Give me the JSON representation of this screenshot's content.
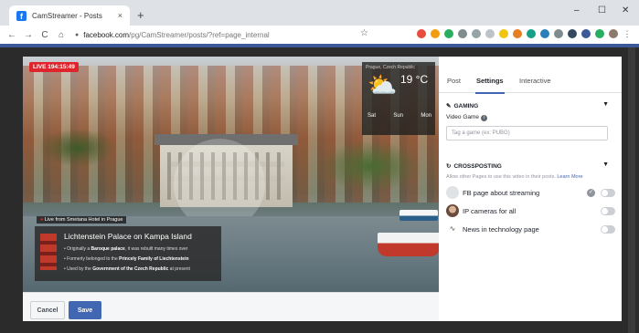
{
  "browser": {
    "tab_title": "CamStreamer - Posts",
    "tab_close": "×",
    "new_tab": "+",
    "url_host": "facebook.com",
    "url_path": "/pg/CamStreamer/posts/?ref=page_internal",
    "win_min": "–",
    "win_max": "☐",
    "win_close": "✕",
    "back": "←",
    "forward": "→",
    "reload": "C",
    "home": "⌂",
    "bookmark_star": "☆"
  },
  "video": {
    "live_badge": "LIVE 194:15:49",
    "location_tag": "Live from Smetana Hotel in Prague",
    "weather": {
      "location": "Prague, Czech Republic",
      "temp": "19 °C",
      "days": [
        {
          "name": "Sat"
        },
        {
          "name": "Sun"
        },
        {
          "name": "Mon"
        }
      ]
    },
    "caption": {
      "title": "Lichtenstein Palace on Kampa Island",
      "line1_pre": "Originally a ",
      "line1_bold": "Baroque palace",
      "line1_post": ", it was rebuilt many times over",
      "line2_pre": "Formerly belonged to the ",
      "line2_bold": "Princely Family of Liechtenstein",
      "line3_pre": "Used by the ",
      "line3_bold": "Government of the Czech Republic",
      "line3_post": " at present"
    }
  },
  "footer": {
    "cancel_label": "Cancel",
    "save_label": "Save"
  },
  "panel": {
    "tabs": [
      "Post",
      "Settings",
      "Interactive"
    ],
    "active_tab": "Settings",
    "gaming": {
      "heading": "GAMING",
      "label": "Video Game",
      "info_icon": "i",
      "placeholder": "Tag a game (ex: PUBG)"
    },
    "crossposting": {
      "heading": "CROSSPOSTING",
      "help": "Allow other Pages to use this video in their posts.",
      "learn_more": "Learn More",
      "pages": [
        {
          "name": "FB page about streaming",
          "verified": true
        },
        {
          "name": "IP cameras for all",
          "verified": false
        },
        {
          "name": "News in technology page",
          "verified": false
        }
      ]
    }
  },
  "colors": {
    "fb_blue": "#4267b2",
    "live_red": "#e0242b"
  }
}
